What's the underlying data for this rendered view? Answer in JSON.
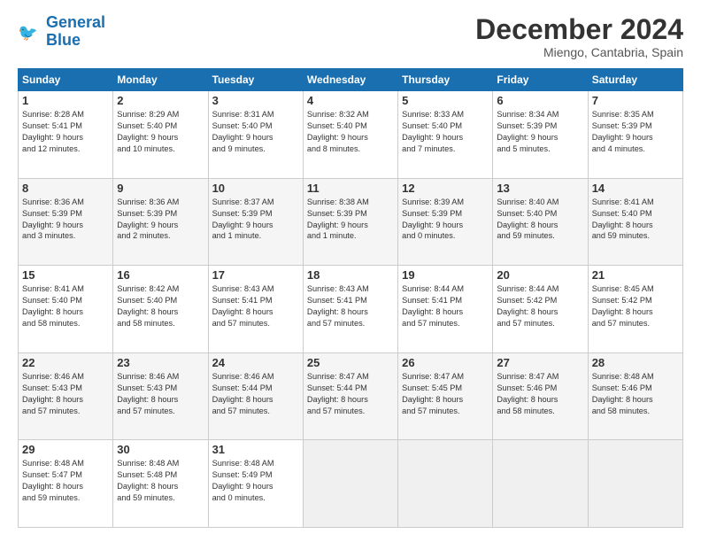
{
  "header": {
    "logo_line1": "General",
    "logo_line2": "Blue",
    "month": "December 2024",
    "location": "Miengo, Cantabria, Spain"
  },
  "weekdays": [
    "Sunday",
    "Monday",
    "Tuesday",
    "Wednesday",
    "Thursday",
    "Friday",
    "Saturday"
  ],
  "weeks": [
    [
      {
        "day": "1",
        "lines": [
          "Sunrise: 8:28 AM",
          "Sunset: 5:41 PM",
          "Daylight: 9 hours",
          "and 12 minutes."
        ]
      },
      {
        "day": "2",
        "lines": [
          "Sunrise: 8:29 AM",
          "Sunset: 5:40 PM",
          "Daylight: 9 hours",
          "and 10 minutes."
        ]
      },
      {
        "day": "3",
        "lines": [
          "Sunrise: 8:31 AM",
          "Sunset: 5:40 PM",
          "Daylight: 9 hours",
          "and 9 minutes."
        ]
      },
      {
        "day": "4",
        "lines": [
          "Sunrise: 8:32 AM",
          "Sunset: 5:40 PM",
          "Daylight: 9 hours",
          "and 8 minutes."
        ]
      },
      {
        "day": "5",
        "lines": [
          "Sunrise: 8:33 AM",
          "Sunset: 5:40 PM",
          "Daylight: 9 hours",
          "and 7 minutes."
        ]
      },
      {
        "day": "6",
        "lines": [
          "Sunrise: 8:34 AM",
          "Sunset: 5:39 PM",
          "Daylight: 9 hours",
          "and 5 minutes."
        ]
      },
      {
        "day": "7",
        "lines": [
          "Sunrise: 8:35 AM",
          "Sunset: 5:39 PM",
          "Daylight: 9 hours",
          "and 4 minutes."
        ]
      }
    ],
    [
      {
        "day": "8",
        "lines": [
          "Sunrise: 8:36 AM",
          "Sunset: 5:39 PM",
          "Daylight: 9 hours",
          "and 3 minutes."
        ]
      },
      {
        "day": "9",
        "lines": [
          "Sunrise: 8:36 AM",
          "Sunset: 5:39 PM",
          "Daylight: 9 hours",
          "and 2 minutes."
        ]
      },
      {
        "day": "10",
        "lines": [
          "Sunrise: 8:37 AM",
          "Sunset: 5:39 PM",
          "Daylight: 9 hours",
          "and 1 minute."
        ]
      },
      {
        "day": "11",
        "lines": [
          "Sunrise: 8:38 AM",
          "Sunset: 5:39 PM",
          "Daylight: 9 hours",
          "and 1 minute."
        ]
      },
      {
        "day": "12",
        "lines": [
          "Sunrise: 8:39 AM",
          "Sunset: 5:39 PM",
          "Daylight: 9 hours",
          "and 0 minutes."
        ]
      },
      {
        "day": "13",
        "lines": [
          "Sunrise: 8:40 AM",
          "Sunset: 5:40 PM",
          "Daylight: 8 hours",
          "and 59 minutes."
        ]
      },
      {
        "day": "14",
        "lines": [
          "Sunrise: 8:41 AM",
          "Sunset: 5:40 PM",
          "Daylight: 8 hours",
          "and 59 minutes."
        ]
      }
    ],
    [
      {
        "day": "15",
        "lines": [
          "Sunrise: 8:41 AM",
          "Sunset: 5:40 PM",
          "Daylight: 8 hours",
          "and 58 minutes."
        ]
      },
      {
        "day": "16",
        "lines": [
          "Sunrise: 8:42 AM",
          "Sunset: 5:40 PM",
          "Daylight: 8 hours",
          "and 58 minutes."
        ]
      },
      {
        "day": "17",
        "lines": [
          "Sunrise: 8:43 AM",
          "Sunset: 5:41 PM",
          "Daylight: 8 hours",
          "and 57 minutes."
        ]
      },
      {
        "day": "18",
        "lines": [
          "Sunrise: 8:43 AM",
          "Sunset: 5:41 PM",
          "Daylight: 8 hours",
          "and 57 minutes."
        ]
      },
      {
        "day": "19",
        "lines": [
          "Sunrise: 8:44 AM",
          "Sunset: 5:41 PM",
          "Daylight: 8 hours",
          "and 57 minutes."
        ]
      },
      {
        "day": "20",
        "lines": [
          "Sunrise: 8:44 AM",
          "Sunset: 5:42 PM",
          "Daylight: 8 hours",
          "and 57 minutes."
        ]
      },
      {
        "day": "21",
        "lines": [
          "Sunrise: 8:45 AM",
          "Sunset: 5:42 PM",
          "Daylight: 8 hours",
          "and 57 minutes."
        ]
      }
    ],
    [
      {
        "day": "22",
        "lines": [
          "Sunrise: 8:46 AM",
          "Sunset: 5:43 PM",
          "Daylight: 8 hours",
          "and 57 minutes."
        ]
      },
      {
        "day": "23",
        "lines": [
          "Sunrise: 8:46 AM",
          "Sunset: 5:43 PM",
          "Daylight: 8 hours",
          "and 57 minutes."
        ]
      },
      {
        "day": "24",
        "lines": [
          "Sunrise: 8:46 AM",
          "Sunset: 5:44 PM",
          "Daylight: 8 hours",
          "and 57 minutes."
        ]
      },
      {
        "day": "25",
        "lines": [
          "Sunrise: 8:47 AM",
          "Sunset: 5:44 PM",
          "Daylight: 8 hours",
          "and 57 minutes."
        ]
      },
      {
        "day": "26",
        "lines": [
          "Sunrise: 8:47 AM",
          "Sunset: 5:45 PM",
          "Daylight: 8 hours",
          "and 57 minutes."
        ]
      },
      {
        "day": "27",
        "lines": [
          "Sunrise: 8:47 AM",
          "Sunset: 5:46 PM",
          "Daylight: 8 hours",
          "and 58 minutes."
        ]
      },
      {
        "day": "28",
        "lines": [
          "Sunrise: 8:48 AM",
          "Sunset: 5:46 PM",
          "Daylight: 8 hours",
          "and 58 minutes."
        ]
      }
    ],
    [
      {
        "day": "29",
        "lines": [
          "Sunrise: 8:48 AM",
          "Sunset: 5:47 PM",
          "Daylight: 8 hours",
          "and 59 minutes."
        ]
      },
      {
        "day": "30",
        "lines": [
          "Sunrise: 8:48 AM",
          "Sunset: 5:48 PM",
          "Daylight: 8 hours",
          "and 59 minutes."
        ]
      },
      {
        "day": "31",
        "lines": [
          "Sunrise: 8:48 AM",
          "Sunset: 5:49 PM",
          "Daylight: 9 hours",
          "and 0 minutes."
        ]
      },
      null,
      null,
      null,
      null
    ]
  ]
}
